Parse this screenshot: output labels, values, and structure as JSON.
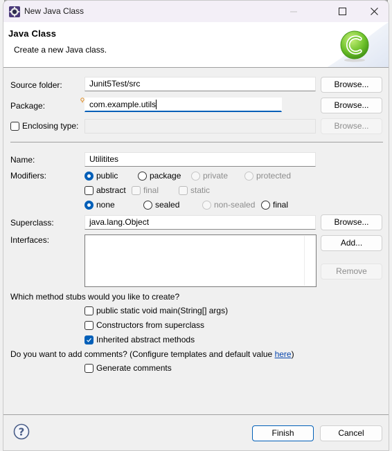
{
  "window": {
    "title": "New Java Class",
    "icon": "eclipse-gear-icon",
    "controls": {
      "minimize": "minimize-icon",
      "maximize": "maximize-icon",
      "close": "close-icon"
    }
  },
  "header": {
    "title": "Java Class",
    "description": "Create a new Java class.",
    "icon": "java-class-c-icon"
  },
  "form": {
    "source_folder": {
      "label": "Source folder:",
      "value": "Junit5Test/src",
      "browse": "Browse..."
    },
    "package": {
      "label": "Package:",
      "value": "com.example.utils",
      "browse": "Browse...",
      "hint_icon": "content-assist-lightbulb-icon"
    },
    "enclosing_type": {
      "label": "Enclosing type:",
      "checked": false,
      "value": "",
      "browse": "Browse..."
    },
    "name": {
      "label": "Name:",
      "value": "Utilitites"
    },
    "modifiers": {
      "label": "Modifiers:",
      "access": [
        {
          "label": "public",
          "selected": true,
          "enabled": true
        },
        {
          "label": "package",
          "selected": false,
          "enabled": true
        },
        {
          "label": "private",
          "selected": false,
          "enabled": false
        },
        {
          "label": "protected",
          "selected": false,
          "enabled": false
        }
      ],
      "flags": [
        {
          "label": "abstract",
          "checked": false,
          "enabled": true
        },
        {
          "label": "final",
          "checked": false,
          "enabled": false
        },
        {
          "label": "static",
          "checked": false,
          "enabled": false
        }
      ],
      "sealing": [
        {
          "label": "none",
          "selected": true,
          "enabled": true
        },
        {
          "label": "sealed",
          "selected": false,
          "enabled": true
        },
        {
          "label": "non-sealed",
          "selected": false,
          "enabled": false
        },
        {
          "label": "final",
          "selected": false,
          "enabled": true
        }
      ]
    },
    "superclass": {
      "label": "Superclass:",
      "value": "java.lang.Object",
      "browse": "Browse..."
    },
    "interfaces": {
      "label": "Interfaces:",
      "items": [],
      "add": "Add...",
      "remove": "Remove"
    },
    "stubs": {
      "question": "Which method stubs would you like to create?",
      "options": [
        {
          "label": "public static void main(String[] args)",
          "checked": false
        },
        {
          "label": "Constructors from superclass",
          "checked": false
        },
        {
          "label": "Inherited abstract methods",
          "checked": true
        }
      ]
    },
    "comments": {
      "question_prefix": "Do you want to add comments? (Configure templates and default value ",
      "link": "here",
      "question_suffix": ")",
      "option": {
        "label": "Generate comments",
        "checked": false
      }
    }
  },
  "footer": {
    "help_icon": "help-icon",
    "finish": "Finish",
    "cancel": "Cancel"
  }
}
